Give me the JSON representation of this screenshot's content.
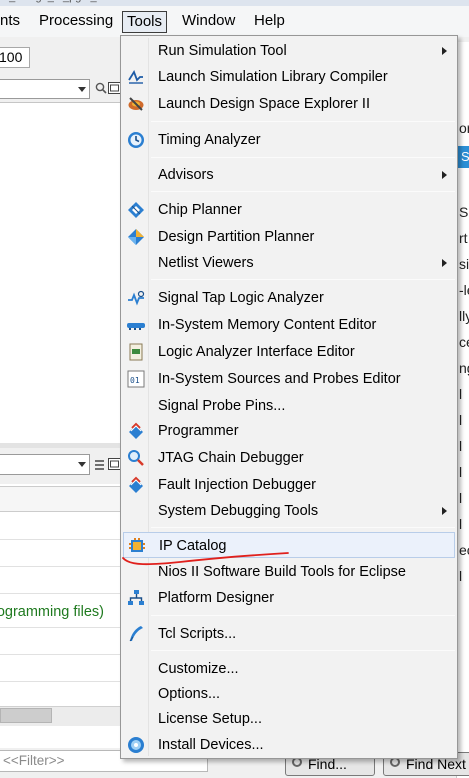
{
  "menubar": {
    "items": [
      "nts",
      "Processing",
      "Tools",
      "Window",
      "Help"
    ],
    "active": "Tools"
  },
  "toolbar": {
    "zoom_value": "100"
  },
  "left_bottom": {
    "status_text": "rogramming files)"
  },
  "filter": {
    "placeholder": "<<Filter>>"
  },
  "right_panel": {
    "tab_letter": "S",
    "row_letters": [
      "or",
      "S",
      "rt",
      "si",
      "-le",
      "lly",
      "ce",
      "ng",
      "l",
      "l",
      "l",
      "l",
      "l",
      "l",
      "ec",
      "l"
    ]
  },
  "buttons": {
    "find": "Find...",
    "find_next": "Find Next"
  },
  "menu": {
    "items": [
      {
        "label": "Run Simulation Tool",
        "icon": "none",
        "submenu": true
      },
      {
        "label": "Launch Simulation Library Compiler",
        "icon": "simulation-library-icon",
        "submenu": false
      },
      {
        "label": "Launch Design Space Explorer II",
        "icon": "design-space-explorer-icon",
        "submenu": false
      },
      {
        "label": "Timing Analyzer",
        "icon": "timing-analyzer-icon",
        "submenu": false
      },
      {
        "label": "Advisors",
        "icon": "none",
        "submenu": true
      },
      {
        "label": "Chip Planner",
        "icon": "chip-planner-icon",
        "submenu": false
      },
      {
        "label": "Design Partition Planner",
        "icon": "design-partition-planner-icon",
        "submenu": false
      },
      {
        "label": "Netlist Viewers",
        "icon": "none",
        "submenu": true
      },
      {
        "label": "Signal Tap Logic Analyzer",
        "icon": "signal-tap-icon",
        "submenu": false
      },
      {
        "label": "In-System Memory Content Editor",
        "icon": "memory-content-editor-icon",
        "submenu": false
      },
      {
        "label": "Logic Analyzer Interface Editor",
        "icon": "logic-analyzer-interface-icon",
        "submenu": false
      },
      {
        "label": "In-System Sources and Probes Editor",
        "icon": "sources-probes-icon",
        "submenu": false
      },
      {
        "label": "Signal Probe Pins...",
        "icon": "none",
        "submenu": false
      },
      {
        "label": "Programmer",
        "icon": "programmer-icon",
        "submenu": false
      },
      {
        "label": "JTAG Chain Debugger",
        "icon": "jtag-chain-debugger-icon",
        "submenu": false
      },
      {
        "label": "Fault Injection Debugger",
        "icon": "fault-injection-debugger-icon",
        "submenu": false
      },
      {
        "label": "System Debugging Tools",
        "icon": "none",
        "submenu": true
      },
      {
        "label": "IP Catalog",
        "icon": "ip-catalog-icon",
        "submenu": false,
        "highlighted": true
      },
      {
        "label": "Nios II Software Build Tools for Eclipse",
        "icon": "none",
        "submenu": false
      },
      {
        "label": "Platform Designer",
        "icon": "platform-designer-icon",
        "submenu": false
      },
      {
        "label": "Tcl Scripts...",
        "icon": "tcl-scripts-icon",
        "submenu": false
      },
      {
        "label": "Customize...",
        "icon": "none",
        "submenu": false
      },
      {
        "label": "Options...",
        "icon": "none",
        "submenu": false
      },
      {
        "label": "License Setup...",
        "icon": "none",
        "submenu": false
      },
      {
        "label": "Install Devices...",
        "icon": "install-devices-icon",
        "submenu": false
      }
    ]
  },
  "colors": {
    "highlight_bg": "#ebf1fb",
    "highlight_border": "#b8cde9",
    "annotation_red": "#e0201c",
    "icon_blue": "#2b7fd1",
    "status_green": "#1f7a1f"
  }
}
